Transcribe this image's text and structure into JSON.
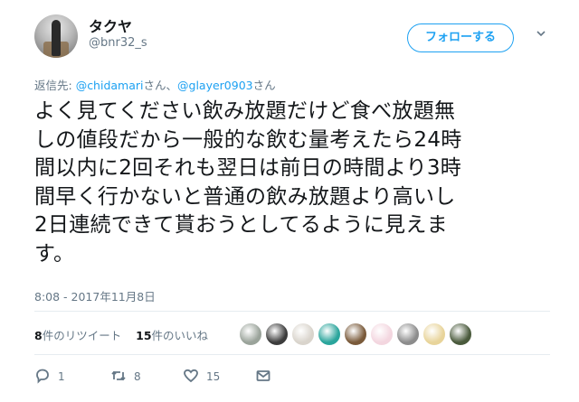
{
  "author": {
    "name": "タクヤ",
    "handle": "@bnr32_s"
  },
  "follow_label": "フォローする",
  "reply_to": {
    "prefix": "返信先: ",
    "mention1": "@chidamari",
    "suffix1": "さん、",
    "mention2": "@glayer0903",
    "suffix2": "さん"
  },
  "tweet_lines": [
    "よく見てください飲み放題だけど食べ放題無",
    "しの値段だから一般的な飲む量考えたら24時",
    "間以内に2回それも翌日は前日の時間より3時",
    "間早く行かないと普通の飲み放題より高いし",
    "2日連続できて貰おうとしてるように見えま",
    "す。"
  ],
  "timestamp": "8:08 - 2017年11月8日",
  "stats": {
    "retweets_count": "8",
    "retweets_label": "件のリツイート",
    "likes_count": "15",
    "likes_label": "件のいいね"
  },
  "liker_colors": [
    "#9aa39a",
    "#3c3c3c",
    "#d9d4cc",
    "#2aa59c",
    "#7a5a3a",
    "#f3d6df",
    "#8c8c8c",
    "#e8d49a",
    "#4a5a3c"
  ],
  "actions": {
    "reply_count": "1",
    "retweet_count": "8",
    "like_count": "15"
  },
  "icons": {
    "reply": "reply-icon",
    "retweet": "retweet-icon",
    "like": "heart-icon",
    "dm": "envelope-icon",
    "more": "chevron-down-icon"
  }
}
